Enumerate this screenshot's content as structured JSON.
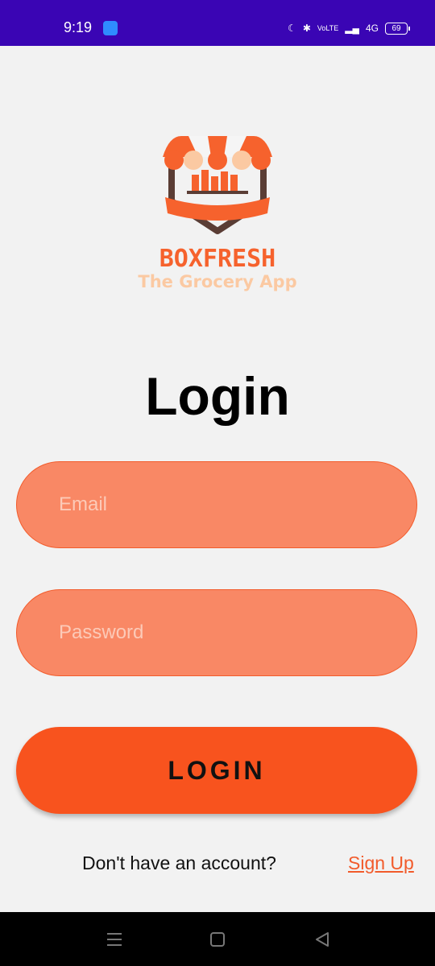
{
  "status_bar": {
    "time": "9:19",
    "battery": "69",
    "network": "4G"
  },
  "logo": {
    "brand": "BOXFRESH",
    "tagline": "The Grocery App",
    "icon": "storefront-awning-icon"
  },
  "title": "Login",
  "form": {
    "email_placeholder": "Email",
    "email_value": "",
    "password_placeholder": "Password",
    "password_value": "",
    "login_label": "LOGIN"
  },
  "footer": {
    "prompt": "Don't have an account?",
    "signup_label": "Sign Up"
  },
  "colors": {
    "status_bar": "#3a05b4",
    "accent": "#f8531e",
    "field_fill": "#f98865",
    "background": "#f2f2f2"
  }
}
